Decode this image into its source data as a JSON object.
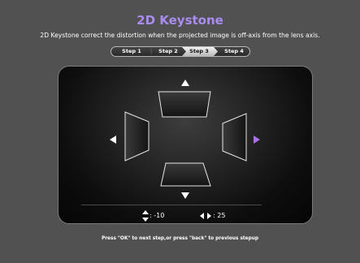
{
  "header": {
    "title": "2D Keystone",
    "description": "2D Keystone correct the distortion when the projected image is off-axis from the lens axis."
  },
  "steps": [
    {
      "label": "Step 1",
      "active": false
    },
    {
      "label": "Step 2",
      "active": false
    },
    {
      "label": "Step 3",
      "active": true
    },
    {
      "label": "Step 4",
      "active": false
    }
  ],
  "readouts": {
    "vertical_value": ": -10",
    "horizontal_value": ": 25"
  },
  "footer": {
    "hint": "Press \"OK\" to next step,or press \"back\" to previous stepup"
  },
  "colors": {
    "title": "#a98cf0",
    "highlight_arrow": "#a970f0",
    "background": "#515151"
  },
  "icons": [
    "up-arrow-icon",
    "down-arrow-icon",
    "left-arrow-icon",
    "right-arrow-icon",
    "vertical-adjust-icon",
    "horizontal-adjust-icon"
  ]
}
